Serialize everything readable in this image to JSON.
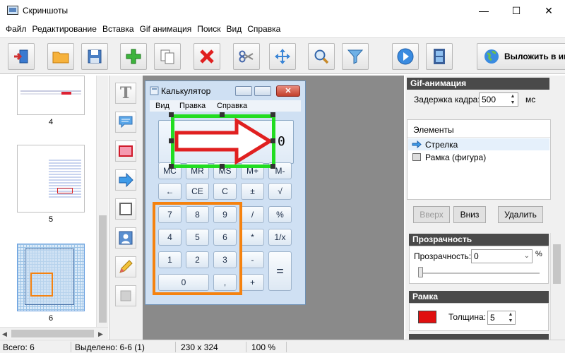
{
  "window": {
    "title": "Скриншоты",
    "minimize_icon": "minimize-icon",
    "maximize_icon": "maximize-icon",
    "close_icon": "close-icon",
    "minimize_glyph": "—",
    "maximize_glyph": "☐",
    "close_glyph": "✕"
  },
  "menu": [
    "Файл",
    "Редактирование",
    "Вставка",
    "Gif анимация",
    "Поиск",
    "Вид",
    "Справка"
  ],
  "toolbar": {
    "icons": [
      "exit-icon",
      "open-folder-icon",
      "save-icon",
      "add-icon",
      "copy-icon",
      "delete-icon",
      "cut-icon",
      "move-icon",
      "search-icon",
      "filter-icon",
      "play-icon",
      "film-icon",
      "globe-icon"
    ],
    "publish_label": "Выложить в ин"
  },
  "thumbnails": [
    {
      "number": "4"
    },
    {
      "number": "5"
    },
    {
      "number": "6"
    }
  ],
  "tools": [
    "text-tool-icon",
    "callout-tool-icon",
    "rectangle-tool-icon",
    "arrow-tool-icon",
    "frame-tool-icon",
    "image-tool-icon",
    "pencil-tool-icon",
    "blur-tool-icon"
  ],
  "calculator": {
    "title": "Калькулятор",
    "menu": [
      "Вид",
      "Правка",
      "Справка"
    ],
    "display": "0",
    "memory_keys": [
      "MC",
      "MR",
      "MS",
      "M+",
      "M-"
    ],
    "keys_row2": [
      "←",
      "CE",
      "C",
      "±",
      "√"
    ],
    "keys_row3": [
      "7",
      "8",
      "9",
      "/",
      "%"
    ],
    "keys_row4": [
      "4",
      "5",
      "6",
      "*",
      "1/x"
    ],
    "keys_row5": [
      "1",
      "2",
      "3",
      "-"
    ],
    "keys_row6": [
      "0",
      ",",
      "+"
    ],
    "equals": "="
  },
  "gif_panel": {
    "header": "Gif-анимация",
    "delay_label": "Задержка кадра:",
    "delay_value": "500",
    "delay_unit": "мс",
    "elements_header": "Элементы",
    "elements": [
      {
        "label": "Стрелка",
        "icon": "arrow-element-icon"
      },
      {
        "label": "Рамка (фигура)",
        "icon": "frame-element-icon"
      }
    ],
    "up_button": "Вверх",
    "down_button": "Вниз",
    "delete_button": "Удалить"
  },
  "opacity_panel": {
    "header": "Прозрачность",
    "label": "Прозрачность:",
    "value": "0",
    "percent": "%",
    "slider_value": 0
  },
  "frame_panel": {
    "header": "Рамка",
    "color": "#e01010",
    "thickness_label": "Толщина:",
    "thickness_value": "5"
  },
  "status": {
    "total": "Всего: 6",
    "selected": "Выделено: 6-6 (1)",
    "size": "230 x 324",
    "zoom": "100 %"
  },
  "colors": {
    "arrow_frame": "#22dd22",
    "arrow_fill": "#ffffff",
    "arrow_stroke": "#e02020",
    "highlight": "#f5820f"
  }
}
